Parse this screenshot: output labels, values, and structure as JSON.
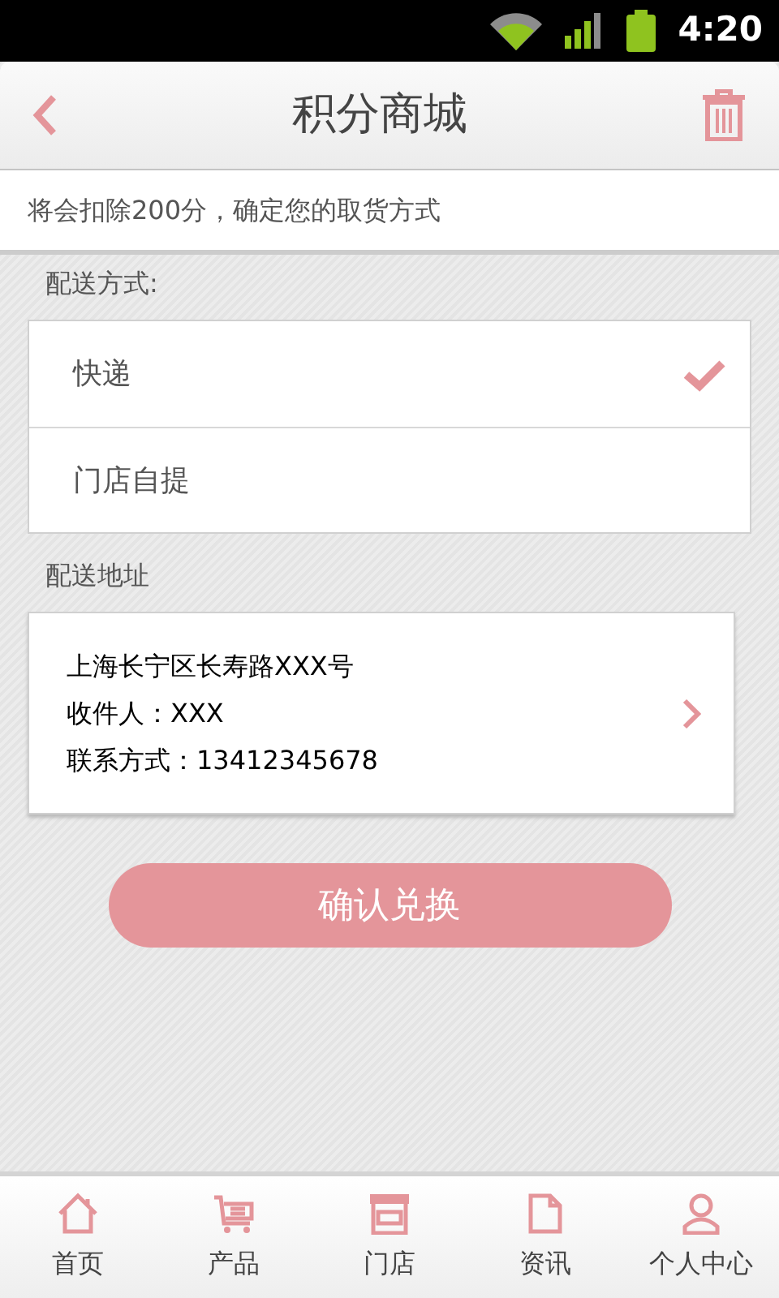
{
  "status_bar": {
    "time": "4:20"
  },
  "header": {
    "title": "积分商城"
  },
  "notice": "将会扣除200分，确定您的取货方式",
  "delivery": {
    "label": "配送方式:",
    "options": [
      {
        "label": "快递",
        "selected": true
      },
      {
        "label": "门店自提",
        "selected": false
      }
    ]
  },
  "address": {
    "label": "配送地址",
    "lines": [
      "上海长宁区长寿路XXX号",
      "收件人：XXX",
      "联系方式：13412345678"
    ]
  },
  "confirm_button": "确认兑换",
  "bottom_nav": [
    {
      "kind": "home",
      "label": "首页"
    },
    {
      "kind": "cart",
      "label": "产品"
    },
    {
      "kind": "store",
      "label": "门店"
    },
    {
      "kind": "doc",
      "label": "资讯"
    },
    {
      "kind": "user",
      "label": "个人中心"
    }
  ]
}
